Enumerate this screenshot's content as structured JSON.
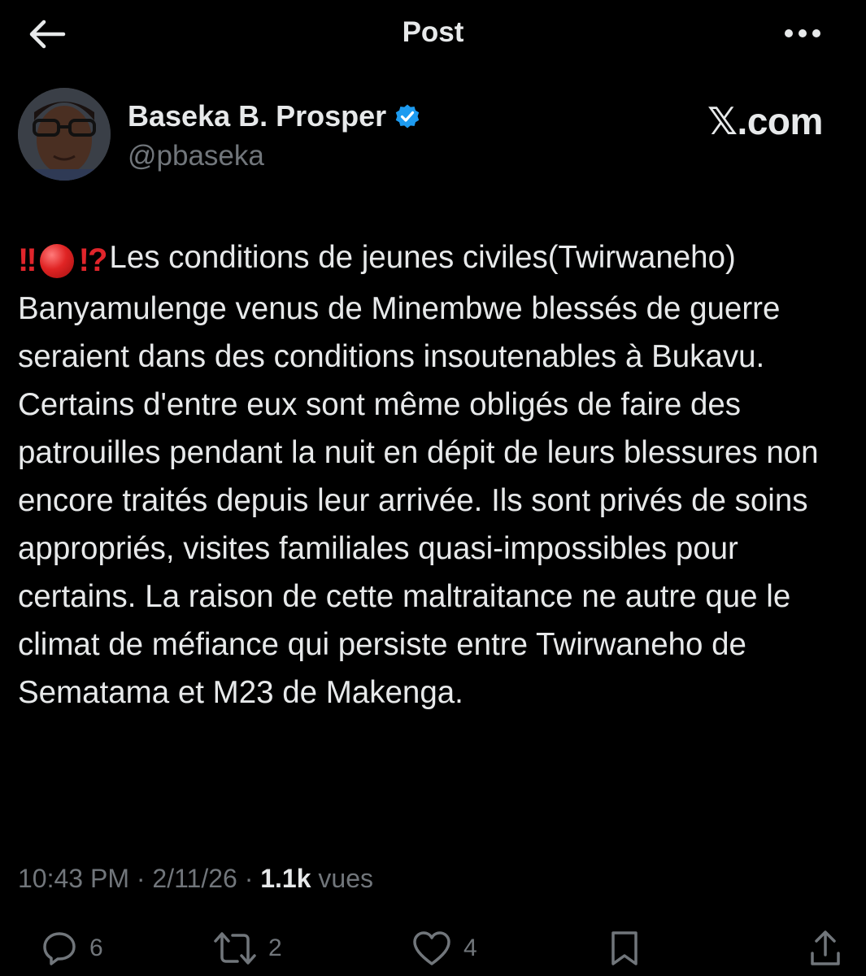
{
  "header": {
    "title": "Post",
    "back_icon": "arrow-left-icon",
    "more_icon": "ellipsis-icon"
  },
  "author": {
    "display_name": "Baseka B. Prosper",
    "handle": "@pbaseka",
    "verified": true,
    "verified_color": "#1d9bf0"
  },
  "watermark": "𝕏.com",
  "post": {
    "emoji_prefix": [
      "double-exclamation",
      "red-circle",
      "interrobang"
    ],
    "text": "Les conditions de jeunes civiles(Twirwaneho) Banyamulenge venus de Minembwe blessés de guerre seraient dans des conditions insoutenables à Bukavu. Certains d'entre eux sont même obligés de faire des patrouilles pendant la nuit en dépit de leurs blessures non encore traités depuis leur arrivée. Ils sont privés de soins appropriés, visites familiales quasi-impossibles pour certains. La raison de cette maltraitance ne autre que le climat de méfiance qui persiste entre Twirwaneho de Sematama et M23 de Makenga."
  },
  "meta": {
    "time": "10:43 PM",
    "separator": "·",
    "date": "2/11/26",
    "views_count": "1.1k",
    "views_label": "vues"
  },
  "actions": {
    "replies": "6",
    "reposts": "2",
    "likes": "4"
  },
  "colors": {
    "background": "#000000",
    "text": "#e7e9ea",
    "secondary": "#71767b",
    "emoji_red": "#e0252b"
  }
}
